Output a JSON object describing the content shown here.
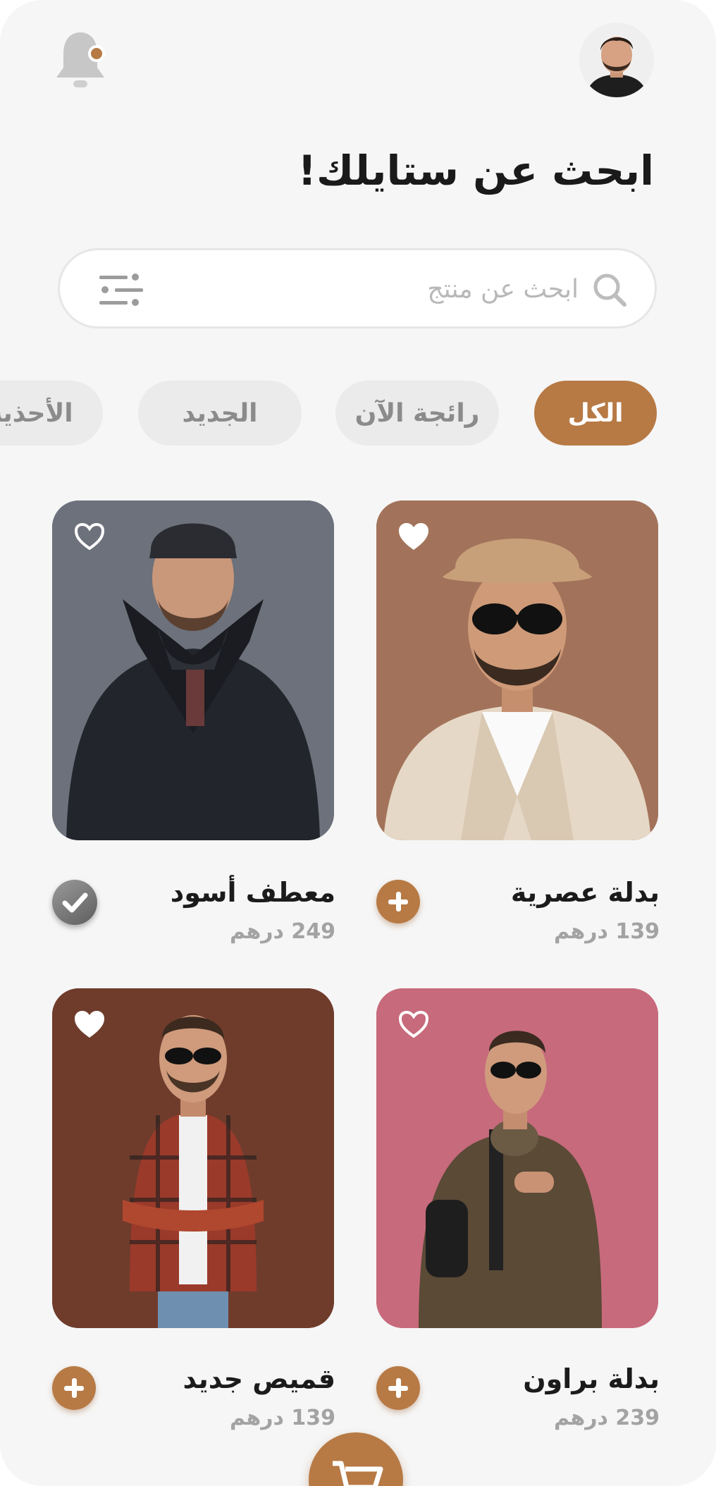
{
  "header": {
    "title": "ابحث عن ستايلك!",
    "notification_icon": "bell-icon",
    "profile_icon": "avatar"
  },
  "search": {
    "placeholder": "ابحث عن منتج",
    "value": ""
  },
  "categories": [
    {
      "label": "الكل",
      "active": true
    },
    {
      "label": "رائجة الآن",
      "active": false
    },
    {
      "label": "الجديد",
      "active": false
    },
    {
      "label": "الأحذية",
      "active": false
    }
  ],
  "products": [
    {
      "name": "بدلة عصرية",
      "price": "139 درهم",
      "action": "add",
      "favorite_icon": "heart-filled-icon"
    },
    {
      "name": "معطف أسود",
      "price": "249 درهم",
      "action": "added",
      "favorite_icon": "heart-outline-icon"
    },
    {
      "name": "بدلة براون",
      "price": "239 درهم",
      "action": "add",
      "favorite_icon": "heart-outline-icon"
    },
    {
      "name": "قميص جديد",
      "price": "139 درهم",
      "action": "add",
      "favorite_icon": "heart-filled-icon"
    }
  ],
  "colors": {
    "accent": "#b77a45",
    "background": "#f6f6f6",
    "chip_inactive": "#ebebeb"
  },
  "cart": {
    "icon": "cart-icon"
  }
}
